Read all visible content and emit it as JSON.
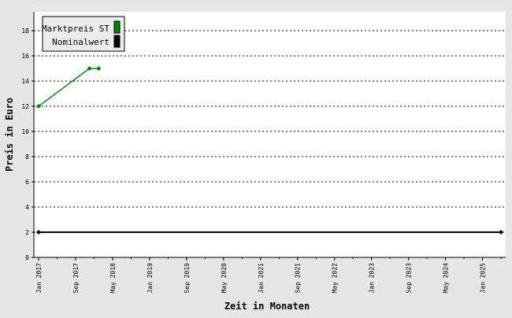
{
  "chart_data": {
    "type": "line",
    "xlabel": "Zeit in Monaten",
    "ylabel": "Preis in Euro",
    "ylim": [
      0,
      19.5
    ],
    "y_ticks": [
      0,
      2,
      4,
      6,
      8,
      10,
      12,
      14,
      16,
      18
    ],
    "x_range": [
      "2017-01",
      "2025-05"
    ],
    "x_ticks": [
      "Jan 2017",
      "Sep 2017",
      "May 2018",
      "Jan 2019",
      "Sep 2019",
      "May 2020",
      "Jan 2021",
      "Sep 2021",
      "May 2022",
      "Jan 2023",
      "Sep 2023",
      "May 2024",
      "Jan 2025"
    ],
    "grid": "horizontal dotted",
    "legend_position": "top-left",
    "series": [
      {
        "name": "Marktpreis ST",
        "color": "#008000",
        "points": [
          {
            "x": "2017-01",
            "y": 12
          },
          {
            "x": "2017-12",
            "y": 15
          },
          {
            "x": "2018-02",
            "y": 15
          }
        ]
      },
      {
        "name": "Nominalwert",
        "color": "#000000",
        "points": [
          {
            "x": "2017-01",
            "y": 2
          },
          {
            "x": "2025-05",
            "y": 2
          }
        ]
      }
    ]
  }
}
